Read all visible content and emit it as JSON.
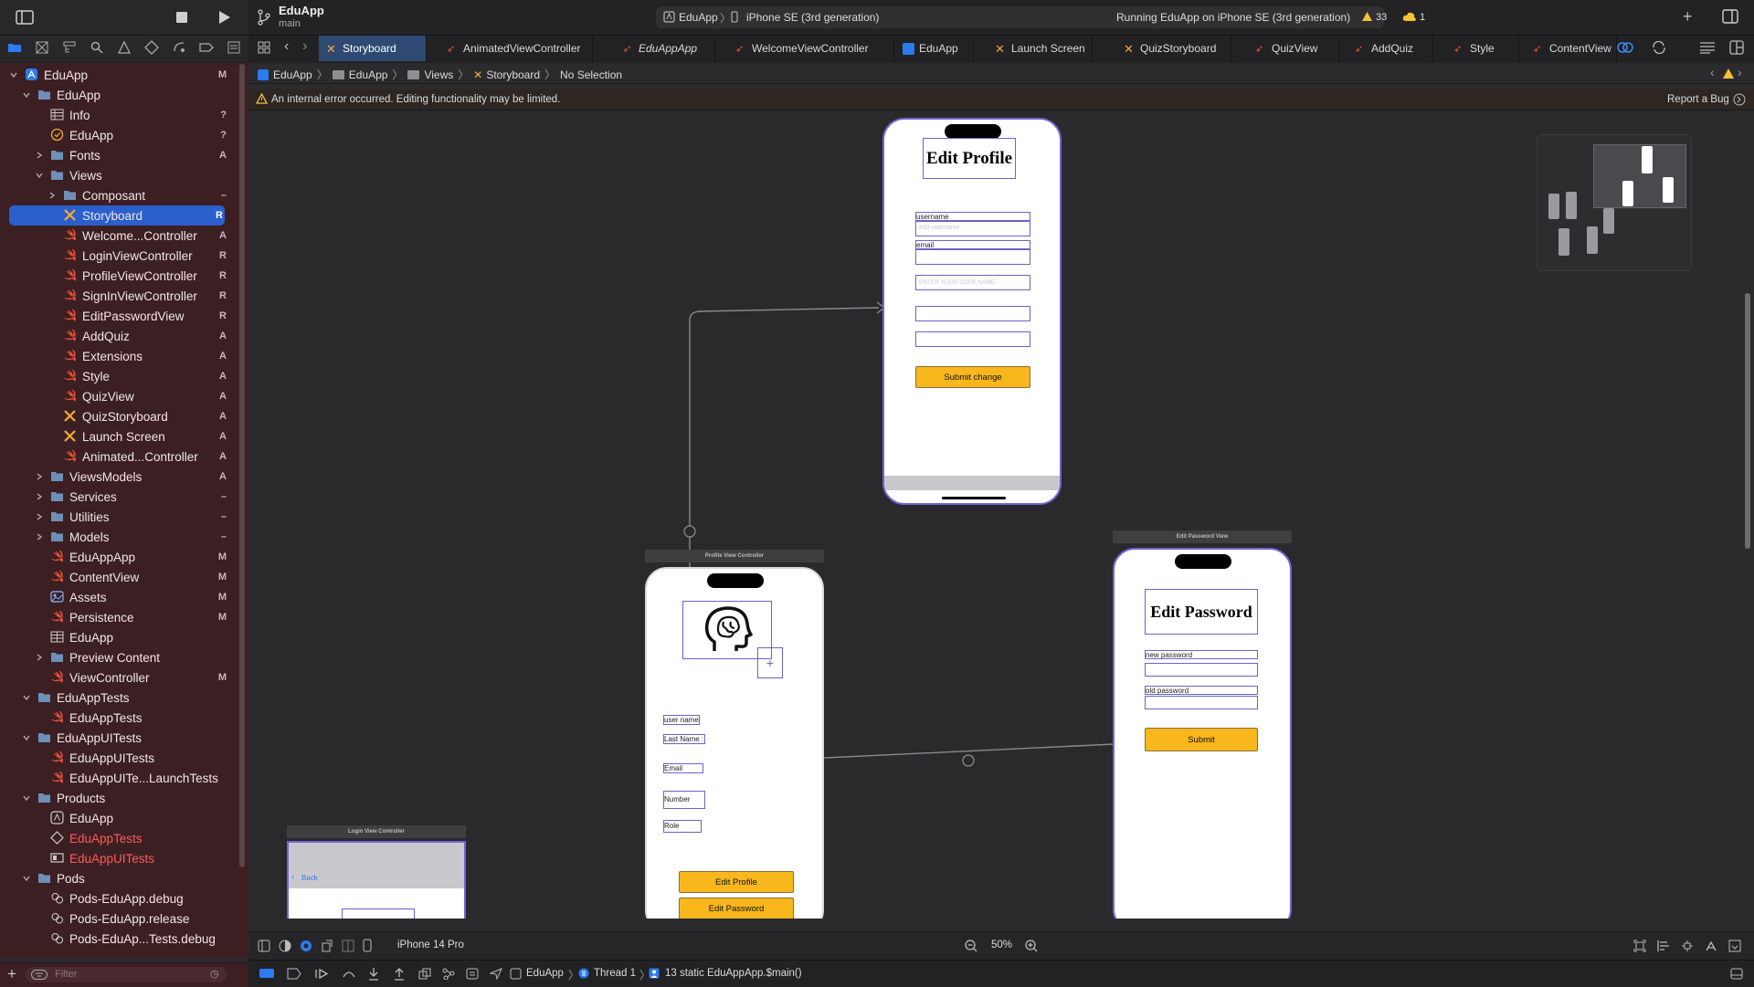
{
  "project": {
    "name": "EduApp",
    "branch": "main"
  },
  "scheme": {
    "target": "EduApp",
    "device": "iPhone SE (3rd generation)",
    "status": "Running EduApp on iPhone SE (3rd generation)",
    "warnings": "33",
    "errors": "1"
  },
  "tabs": [
    {
      "label": "Storyboard",
      "icon": "storyboard-icon",
      "active": true
    },
    {
      "label": "AnimatedViewController",
      "icon": "swift-icon"
    },
    {
      "label": "EduAppApp",
      "icon": "swift-icon",
      "italic": true
    },
    {
      "label": "WelcomeViewController",
      "icon": "swift-icon"
    },
    {
      "label": "EduApp",
      "icon": "project-icon"
    },
    {
      "label": "Launch Screen",
      "icon": "storyboard-icon"
    },
    {
      "label": "QuizStoryboard",
      "icon": "storyboard-icon"
    },
    {
      "label": "QuizView",
      "icon": "swift-icon"
    },
    {
      "label": "AddQuiz",
      "icon": "swift-icon"
    },
    {
      "label": "Style",
      "icon": "swift-icon"
    },
    {
      "label": "ContentView",
      "icon": "swift-icon"
    }
  ],
  "breadcrumb": [
    "EduApp",
    "EduApp",
    "Views",
    "Storyboard",
    "No Selection"
  ],
  "error_banner": {
    "message": "An internal error occurred. Editing functionality may be limited.",
    "action": "Report a Bug"
  },
  "navigator": [
    {
      "label": "EduApp",
      "icon": "project-icon",
      "level": 0,
      "chevron": "open",
      "badge": "M"
    },
    {
      "label": "EduApp",
      "icon": "folder-icon",
      "level": 1,
      "chevron": "open",
      "badge": ""
    },
    {
      "label": "Info",
      "icon": "plist-icon",
      "level": 2,
      "badge": "?"
    },
    {
      "label": "EduApp",
      "icon": "entitlements-icon",
      "level": 2,
      "badge": "?"
    },
    {
      "label": "Fonts",
      "icon": "folder-icon",
      "level": 2,
      "chevron": "closed",
      "badge": "A"
    },
    {
      "label": "Views",
      "icon": "folder-icon",
      "level": 2,
      "chevron": "open",
      "badge": ""
    },
    {
      "label": "Composant",
      "icon": "folder-icon",
      "level": 3,
      "chevron": "closed",
      "badge": "–"
    },
    {
      "label": "Storyboard",
      "icon": "storyboard-icon",
      "level": 3,
      "badge": "R",
      "selected": true
    },
    {
      "label": "Welcome...Controller",
      "icon": "swift-icon",
      "level": 3,
      "badge": "A"
    },
    {
      "label": "LoginViewController",
      "icon": "swift-icon",
      "level": 3,
      "badge": "R"
    },
    {
      "label": "ProfileViewController",
      "icon": "swift-icon",
      "level": 3,
      "badge": "R"
    },
    {
      "label": "SignInViewController",
      "icon": "swift-icon",
      "level": 3,
      "badge": "R"
    },
    {
      "label": "EditPasswordView",
      "icon": "swift-icon",
      "level": 3,
      "badge": "R"
    },
    {
      "label": "AddQuiz",
      "icon": "swift-icon",
      "level": 3,
      "badge": "A"
    },
    {
      "label": "Extensions",
      "icon": "swift-icon",
      "level": 3,
      "badge": "A"
    },
    {
      "label": "Style",
      "icon": "swift-icon",
      "level": 3,
      "badge": "A"
    },
    {
      "label": "QuizView",
      "icon": "swift-icon",
      "level": 3,
      "badge": "A"
    },
    {
      "label": "QuizStoryboard",
      "icon": "storyboard-icon",
      "level": 3,
      "badge": "A"
    },
    {
      "label": "Launch Screen",
      "icon": "storyboard-icon",
      "level": 3,
      "badge": "A"
    },
    {
      "label": "Animated...Controller",
      "icon": "swift-icon",
      "level": 3,
      "badge": "A"
    },
    {
      "label": "ViewsModels",
      "icon": "folder-icon",
      "level": 2,
      "chevron": "closed",
      "badge": "A"
    },
    {
      "label": "Services",
      "icon": "folder-icon",
      "level": 2,
      "chevron": "closed",
      "badge": "–"
    },
    {
      "label": "Utilities",
      "icon": "folder-icon",
      "level": 2,
      "chevron": "closed",
      "badge": "–"
    },
    {
      "label": "Models",
      "icon": "folder-icon",
      "level": 2,
      "chevron": "closed",
      "badge": "–"
    },
    {
      "label": "EduAppApp",
      "icon": "swift-icon",
      "level": 2,
      "badge": "M"
    },
    {
      "label": "ContentView",
      "icon": "swift-icon",
      "level": 2,
      "badge": "M"
    },
    {
      "label": "Assets",
      "icon": "assets-icon",
      "level": 2,
      "badge": "M"
    },
    {
      "label": "Persistence",
      "icon": "swift-icon",
      "level": 2,
      "badge": "M"
    },
    {
      "label": "EduApp",
      "icon": "datamodel-icon",
      "level": 2,
      "badge": ""
    },
    {
      "label": "Preview Content",
      "icon": "folder-icon",
      "level": 2,
      "chevron": "closed",
      "badge": ""
    },
    {
      "label": "ViewController",
      "icon": "swift-icon",
      "level": 2,
      "badge": "M"
    },
    {
      "label": "EduAppTests",
      "icon": "folder-icon",
      "level": 1,
      "chevron": "open",
      "badge": ""
    },
    {
      "label": "EduAppTests",
      "icon": "swift-icon",
      "level": 2,
      "badge": ""
    },
    {
      "label": "EduAppUITests",
      "icon": "folder-icon",
      "level": 1,
      "chevron": "open",
      "badge": ""
    },
    {
      "label": "EduAppUITests",
      "icon": "swift-icon",
      "level": 2,
      "badge": ""
    },
    {
      "label": "EduAppUITe...LaunchTests",
      "icon": "swift-icon",
      "level": 2,
      "badge": ""
    },
    {
      "label": "Products",
      "icon": "folder-icon",
      "level": 1,
      "chevron": "open",
      "badge": ""
    },
    {
      "label": "EduApp",
      "icon": "app-icon",
      "level": 2,
      "badge": ""
    },
    {
      "label": "EduAppTests",
      "icon": "bundle-icon",
      "level": 2,
      "badge": "",
      "red": true
    },
    {
      "label": "EduAppUITests",
      "icon": "uitest-icon",
      "level": 2,
      "badge": "",
      "red": true
    },
    {
      "label": "Pods",
      "icon": "folder-icon",
      "level": 1,
      "chevron": "open",
      "badge": ""
    },
    {
      "label": "Pods-EduApp.debug",
      "icon": "xcconfig-icon",
      "level": 2,
      "badge": ""
    },
    {
      "label": "Pods-EduApp.release",
      "icon": "xcconfig-icon",
      "level": 2,
      "badge": ""
    },
    {
      "label": "Pods-EduAp...Tests.debug",
      "icon": "xcconfig-icon",
      "level": 2,
      "badge": ""
    }
  ],
  "filter": {
    "placeholder": "Filter"
  },
  "storyboard": {
    "edit_profile": {
      "title": "Edit Profile",
      "username_label": "username",
      "username_placeholder": "edit username",
      "email_label": "email",
      "field_placeholder": "ENTER YOUR USER NAME",
      "submit": "Submit change"
    },
    "profile_vc": {
      "scene_title": "Profile View Controller",
      "user_name": "user name",
      "last_name": "Last Name :",
      "email": "Email",
      "number": "Number",
      "role": "Role",
      "edit_profile": "Edit Profile",
      "edit_password": "Edit Password"
    },
    "edit_password_vc": {
      "scene_title": "Edit Password View",
      "title": "Edit Password",
      "new_password": "new password",
      "old_password": "old password",
      "submit": "Submit"
    },
    "login_vc": {
      "scene_title": "Login View Controller",
      "back": "Back"
    }
  },
  "canvas_footer": {
    "device": "iPhone 14 Pro",
    "zoom": "50%"
  },
  "debug_bar": {
    "app": "EduApp",
    "thread": "Thread 1",
    "frame": "13 static EduAppApp.$main()"
  },
  "colors": {
    "accent": "#f8b71c",
    "selection": "#2b5fcc",
    "sidebar": "#3c1f23"
  }
}
